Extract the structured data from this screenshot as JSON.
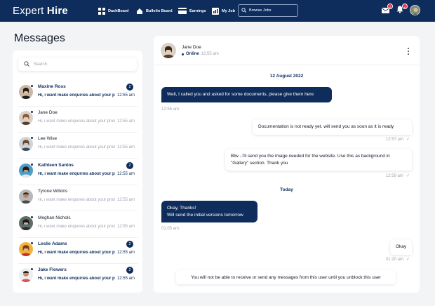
{
  "app": {
    "logo_prefix": "Expert ",
    "logo_bold": "Hire"
  },
  "nav": {
    "dashboard": "DashBoard",
    "bulletin": "Bulletin Board",
    "earnings": "Earnings",
    "myjob": "My Job",
    "browse": "Browse Jobs"
  },
  "top": {
    "mail_count": "2",
    "notif_count": "2"
  },
  "page": {
    "title": "Messages",
    "search_placeholder": "Search"
  },
  "contacts": [
    {
      "name": "Maxine Ross",
      "preview": "Hi, i want make enquiries about your product",
      "time": "12:55 am",
      "unread": "2"
    },
    {
      "name": "Jane Doe",
      "preview": "Hi, i want make enquiries about your product",
      "time": "12:55 am",
      "unread": ""
    },
    {
      "name": "Lee Wise",
      "preview": "Hi, i want make enquiries about your product",
      "time": "12:55 am",
      "unread": ""
    },
    {
      "name": "Kathleen Santos",
      "preview": "Hi, i want make enquiries about your product",
      "time": "12:55 am",
      "unread": "2"
    },
    {
      "name": "Tyrone Wilkins",
      "preview": "Hi, i want make enquiries about your product",
      "time": "12:55 am",
      "unread": ""
    },
    {
      "name": "Meghan Nichols",
      "preview": "Hi, i want make enquiries about your product",
      "time": "12:55 am",
      "unread": ""
    },
    {
      "name": "Leslie Adams",
      "preview": "Hi, i want make enquiries about your product",
      "time": "12:55 am",
      "unread": "2"
    },
    {
      "name": "Jake Flowers",
      "preview": "Hi, i want make enquiries about your product",
      "time": "12:55 am",
      "unread": "2"
    }
  ],
  "chat": {
    "name": "Jane Doe",
    "status": "Online",
    "status_time": "12:55 am",
    "day1": "12 August 2022",
    "day2": "Today",
    "messages": [
      {
        "text": "Well, I called you and asked for some documents, please give them here",
        "time": "12:55 am"
      },
      {
        "text": "Documentation is not ready yet. will send you as soon as it is ready",
        "time": "12:57 am"
      },
      {
        "text": "Btw ..I'll send you the image needed for the website. Use this as background in \"Gallery\" section. Thank you",
        "time": "12:59 am"
      },
      {
        "line1": "Okay, Thanks!",
        "line2": "Will send the initial versions tomorrow",
        "time": "01:05 am"
      },
      {
        "text": "Okay",
        "time": "01:20 am"
      }
    ],
    "notice": "You will not be able to receive or send any messages from this user until you unblock this user"
  },
  "colors": {
    "brand": "#0f2d5c",
    "badge": "#e11d48"
  },
  "icons": [
    "dashboard-icon",
    "bulletin-home-icon",
    "earnings-card-icon",
    "myjob-icon",
    "search-icon",
    "mail-icon",
    "bell-icon",
    "read-check-icon",
    "more-vertical-icon"
  ]
}
